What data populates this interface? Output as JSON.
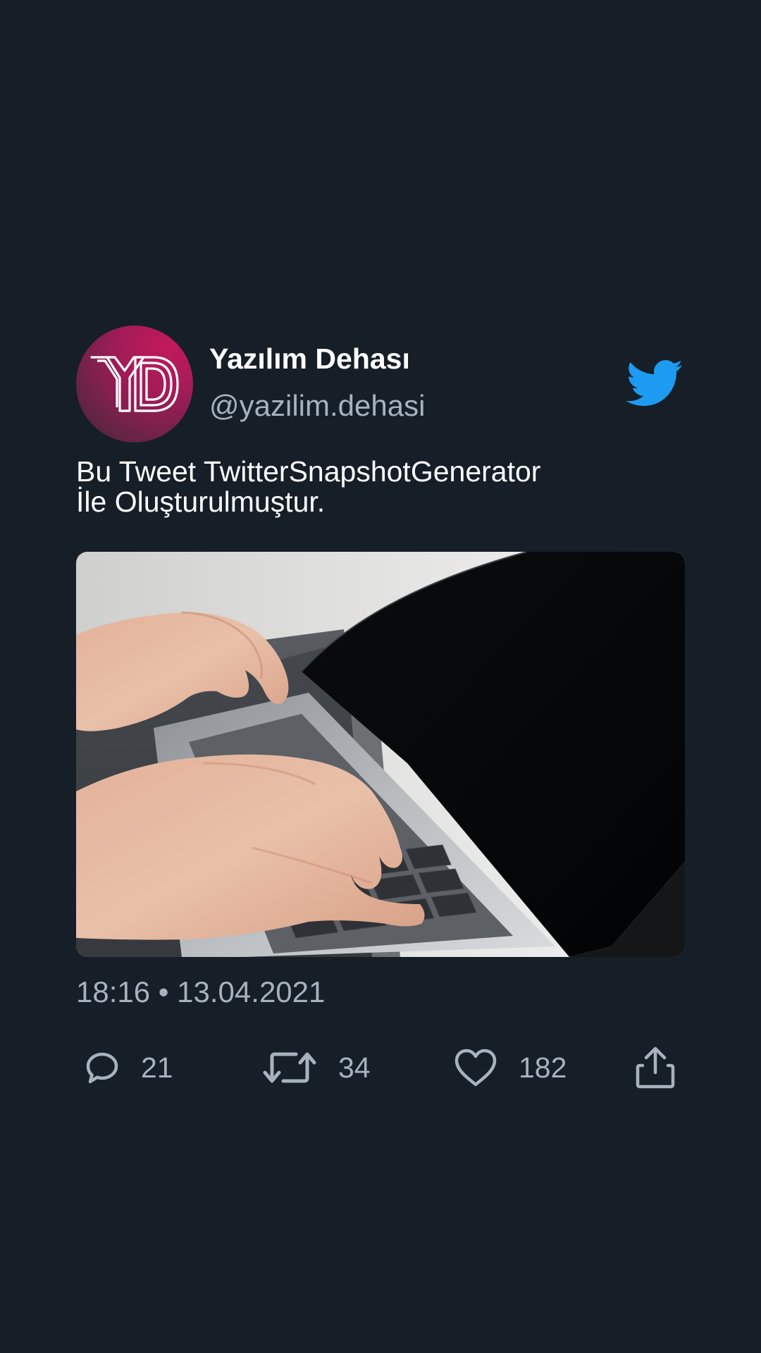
{
  "tweet": {
    "avatar_initials": "YD",
    "display_name": "Yazılım Dehası",
    "handle": "@yazilim.dehasi",
    "text_lines": [
      "Bu Tweet TwitterSnapshotGenerator",
      "İle Oluşturulmuştur."
    ],
    "time": "18:16",
    "separator": "•",
    "date": "13.04.2021",
    "counts": {
      "replies": "21",
      "retweets": "34",
      "likes": "182"
    }
  },
  "icons": {
    "brand": "twitter-bird-icon",
    "reply": "reply-icon",
    "retweet": "retweet-icon",
    "like": "heart-icon",
    "share": "share-icon"
  },
  "colors": {
    "background": "#161e28",
    "text_primary": "#ffffff",
    "text_secondary": "#a7b2bf",
    "twitter_blue": "#1d9bf0",
    "avatar_accent": "#c3195a"
  }
}
